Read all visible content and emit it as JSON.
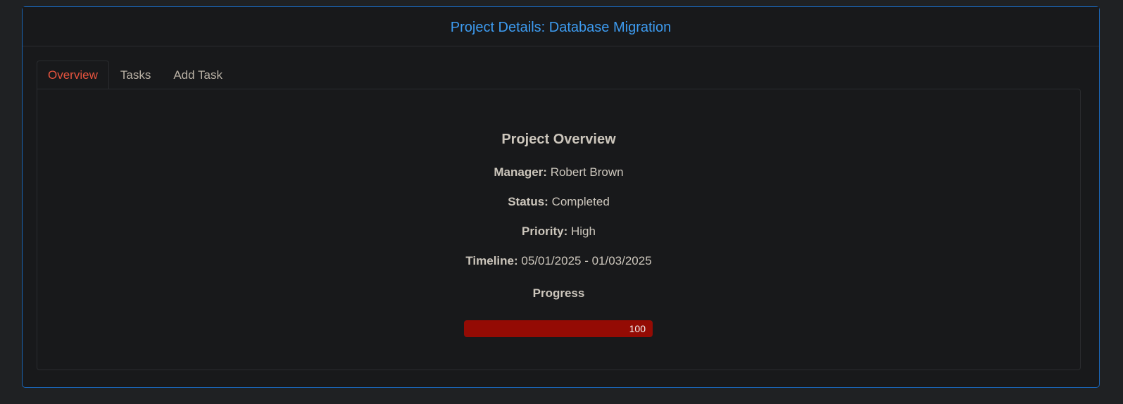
{
  "header": {
    "title": "Project Details: Database Migration"
  },
  "tabs": [
    {
      "label": "Overview",
      "active": true
    },
    {
      "label": "Tasks",
      "active": false
    },
    {
      "label": "Add Task",
      "active": false
    }
  ],
  "overview": {
    "heading": "Project Overview",
    "manager": {
      "label": "Manager:",
      "value": "Robert Brown"
    },
    "status": {
      "label": "Status:",
      "value": "Completed"
    },
    "priority": {
      "label": "Priority:",
      "value": "High"
    },
    "timeline": {
      "label": "Timeline:",
      "value": "05/01/2025 - 01/03/2025"
    },
    "progress": {
      "label": "Progress",
      "value": 100,
      "text": "100"
    }
  },
  "colors": {
    "accent": "#3d9bf0",
    "active_tab": "#e5533e",
    "progress_fill": "#940b04"
  }
}
